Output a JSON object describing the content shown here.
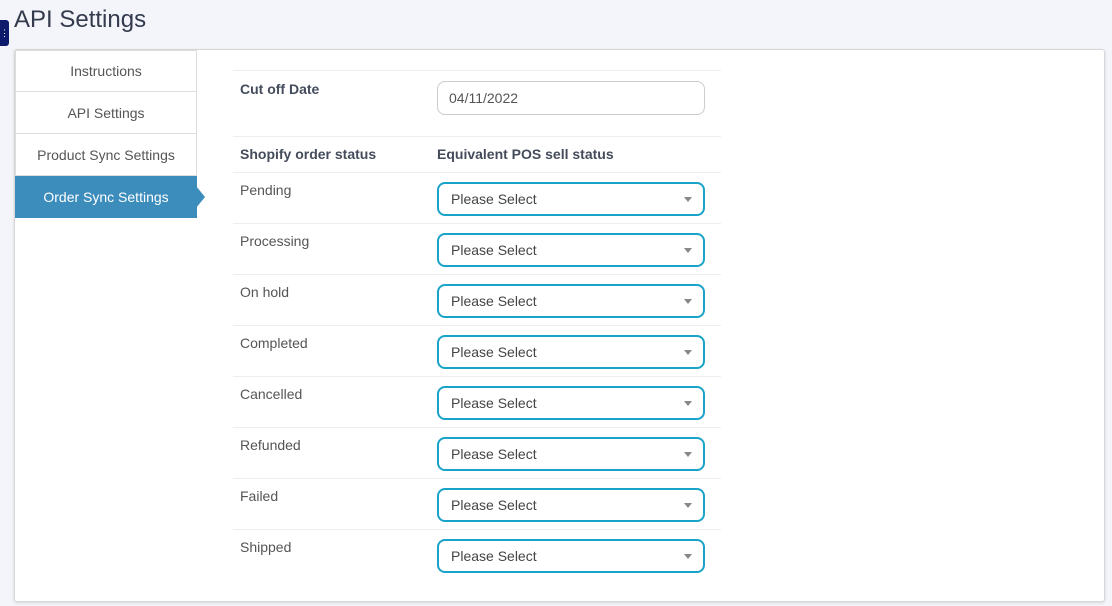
{
  "page_title": "API Settings",
  "toggle_glyph": "⋮",
  "tabs": [
    {
      "label": "Instructions"
    },
    {
      "label": "API Settings"
    },
    {
      "label": "Product Sync Settings"
    },
    {
      "label": "Order Sync Settings"
    }
  ],
  "active_tab": 3,
  "cutoff": {
    "label": "Cut off Date",
    "value": "04/11/2022"
  },
  "columns": {
    "shopify": "Shopify order status",
    "pos": "Equivalent POS sell status"
  },
  "statuses": [
    {
      "label": "Pending",
      "selected": "Please Select"
    },
    {
      "label": "Processing",
      "selected": "Please Select"
    },
    {
      "label": "On hold",
      "selected": "Please Select"
    },
    {
      "label": "Completed",
      "selected": "Please Select"
    },
    {
      "label": "Cancelled",
      "selected": "Please Select"
    },
    {
      "label": "Refunded",
      "selected": "Please Select"
    },
    {
      "label": "Failed",
      "selected": "Please Select"
    },
    {
      "label": "Shipped",
      "selected": "Please Select"
    }
  ],
  "colors": {
    "accent": "#3c8dbc",
    "select_border": "#1aa3c8",
    "toggle": "#0e1a6b"
  }
}
